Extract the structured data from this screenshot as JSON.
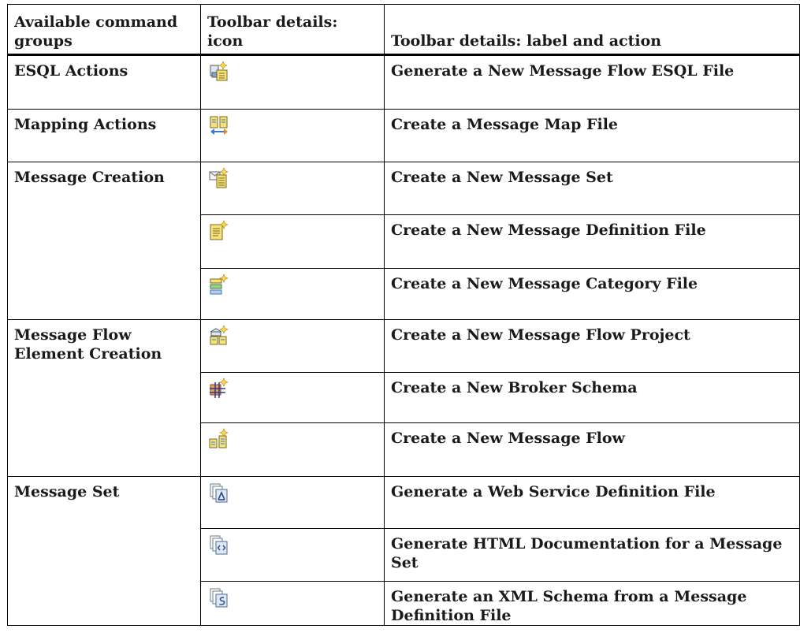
{
  "table": {
    "headers": {
      "groups": "Available command groups",
      "icon": "Toolbar details: icon",
      "action": "Toolbar details: label and action"
    },
    "rows": [
      {
        "group": "ESQL Actions",
        "icon": "esql-file-icon",
        "action": "Generate a New Message Flow ESQL File"
      },
      {
        "group": "Mapping Actions",
        "icon": "message-map-icon",
        "action": "Create a Message Map File"
      },
      {
        "group": "Message Creation",
        "icon": "message-set-icon",
        "action": "Create a New Message Set"
      },
      {
        "group": "",
        "icon": "message-definition-icon",
        "action": "Create a New Message Definition File"
      },
      {
        "group": "",
        "icon": "message-category-icon",
        "action": "Create a New Message Category File"
      },
      {
        "group": "Message Flow Element Creation",
        "icon": "flow-project-icon",
        "action": "Create a New Message Flow Project"
      },
      {
        "group": "",
        "icon": "broker-schema-icon",
        "action": "Create a New Broker Schema"
      },
      {
        "group": "",
        "icon": "message-flow-icon",
        "action": "Create a New Message Flow"
      },
      {
        "group": "Message Set",
        "icon": "wsdl-icon",
        "action": "Generate a Web Service Definition File"
      },
      {
        "group": "",
        "icon": "html-doc-icon",
        "action": "Generate HTML Documentation for a Message Set"
      },
      {
        "group": "",
        "icon": "xml-schema-icon",
        "action": "Generate an XML Schema from a Message Definition File"
      }
    ]
  },
  "colors": {
    "border": "#000000",
    "icon_yellow": "#f5e27a",
    "icon_blue": "#3a78c8",
    "icon_orange": "#e08a2a"
  }
}
